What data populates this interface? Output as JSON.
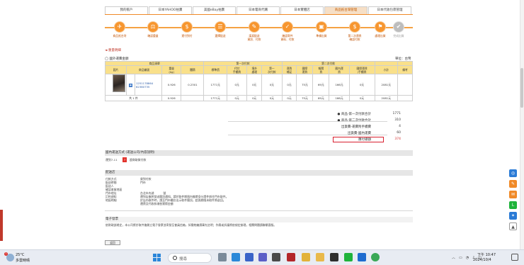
{
  "tabs": [
    {
      "label": "我的帳戶"
    },
    {
      "label": "日本YAHOO拍賣"
    },
    {
      "label": "美國eBay拍賣"
    },
    {
      "label": "日本電商代購"
    },
    {
      "label": "日本實體店"
    },
    {
      "label": "商品抵台灣管理"
    },
    {
      "label": "日本代收包裹管理"
    }
  ],
  "steps": [
    {
      "label": "商品抵台灣"
    },
    {
      "label": "確認重量"
    },
    {
      "label": "運付到付"
    },
    {
      "label": "選擇配送"
    },
    {
      "label": "填寫配送\n資訊、付款"
    },
    {
      "label": "確認寄件\n資料、付款"
    },
    {
      "label": "準備出貨"
    },
    {
      "label": "第二次運費\n確認付款"
    },
    {
      "label": "處理出貨"
    },
    {
      "label": "完成出貨"
    }
  ],
  "back_link": "◄ 重量明細",
  "radio_label": "國外運費金額",
  "unit_label": "單位：台幣",
  "table": {
    "head_product": "商品清單",
    "head_first": "第一次付款",
    "head_second": "第二次付款",
    "cols": [
      "圖片",
      "商品編號",
      "重量\n(kg)",
      "體積",
      "標準價",
      "代付\n手續費",
      "境外\n處理",
      "第一\n次付款",
      "運費\n補足",
      "國際\n運費",
      "報關\n費",
      "國內運\n費",
      "合計",
      "國際運費\n/手續費",
      "小計",
      "備考"
    ],
    "row": {
      "ids": "1251178864\n62380735",
      "weight": "0.926",
      "volume": "0.2301",
      "v1": "1771元",
      "v2": "0元",
      "v3": "0元",
      "v4": "0元",
      "v5": "0元",
      "v6": "75元",
      "v7": "69元",
      "v8": "166元",
      "v9": "0元",
      "v10": "2081元"
    },
    "total": {
      "label": "共 1 件",
      "weight": "0.926",
      "v1": "1771元",
      "v2": "0元",
      "v3": "0元",
      "v4": "0元",
      "v5": "0元",
      "v6": "75元",
      "v7": "69元",
      "v8": "166元",
      "v9": "0元",
      "v10": "2081元"
    }
  },
  "summary": [
    {
      "k": "● 商品-第一次付款合計",
      "v": "1771"
    },
    {
      "k": "● 商品-第二次付款合計",
      "v": "310"
    },
    {
      "k": "出貨費-運費附手續費",
      "v": "4"
    },
    {
      "k": "出貨費-國內運費",
      "v": "60"
    },
    {
      "k": "應付總額",
      "v": "374"
    }
  ],
  "delivery": {
    "title": "國內運送方式 (運送公司/內容說明)",
    "method": "運到7-11",
    "store": "超商取貨付款"
  },
  "shipping": {
    "title": "配送店",
    "rows": [
      {
        "k": "付款方式",
        "v": "貨到付款"
      },
      {
        "k": "配送時間",
        "v": "門市"
      },
      {
        "k": "配送人",
        "v": ""
      },
      {
        "k": "確認收貨地區",
        "v": ""
      },
      {
        "k": "門市地址",
        "v": "台北市內湖  　　　號"
      },
      {
        "k": "訂約須知",
        "v": "運到店後將發送簡訊通知，請於取件期限內攜帶身分證件前往門市取件。"
      },
      {
        "k": "地配明細",
        "v": "於店內取件時，請至門市櫃台出示取件簡訊，超過期限未取件將退回。"
      }
    ],
    "note": "運費及代收款項依實際金額"
  },
  "invoice": {
    "title": "電子發票",
    "text": "依財政部規定，本公司將於取件後開立電子發票並寄發至會員信箱，如需統編請事先註明；作廢或折讓將依規定辦理，相關問題請聯繫客服。"
  },
  "button": "返回",
  "taskbar": {
    "temp": "25°C",
    "weather": "多雲時晴",
    "badge": "1",
    "search": "搜尋",
    "time": "下午 10:47",
    "date": "2024/10/4"
  },
  "colors": {
    "accent": "#f7962f",
    "header": "#f9e08a",
    "highlight": "#d9202f"
  }
}
